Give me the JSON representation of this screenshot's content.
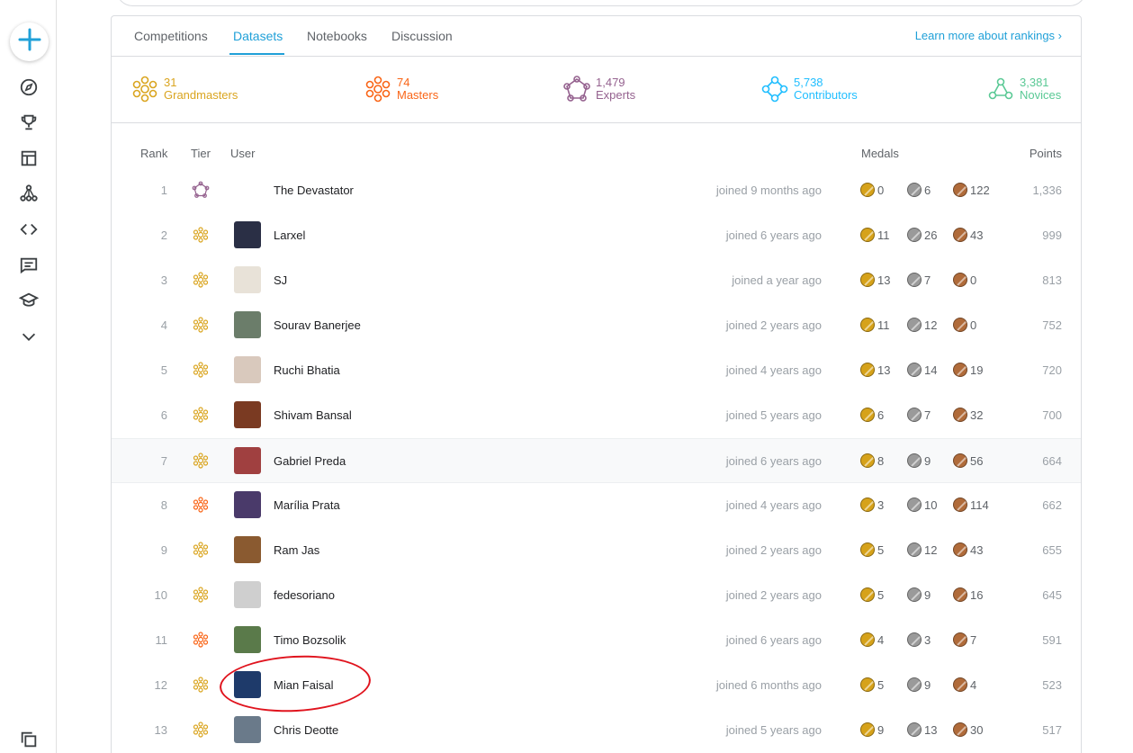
{
  "sidebar": {
    "icons": [
      "plus-icon",
      "compass-icon",
      "trophy-icon",
      "table-icon",
      "model-icon",
      "code-icon",
      "discussion-icon",
      "learn-icon",
      "chevron-down-icon",
      "copy-icon"
    ]
  },
  "tabs": [
    {
      "label": "Competitions",
      "active": false
    },
    {
      "label": "Datasets",
      "active": true
    },
    {
      "label": "Notebooks",
      "active": false
    },
    {
      "label": "Discussion",
      "active": false
    }
  ],
  "learn_more": "Learn more about rankings ›",
  "tiers": [
    {
      "count": "31",
      "label": "Grandmasters",
      "color": "#daa520"
    },
    {
      "count": "74",
      "label": "Masters",
      "color": "#f96517"
    },
    {
      "count": "1,479",
      "label": "Experts",
      "color": "#95628f"
    },
    {
      "count": "5,738",
      "label": "Contributors",
      "color": "#20beff"
    },
    {
      "count": "3,381",
      "label": "Novices",
      "color": "#5ac995"
    }
  ],
  "headers": {
    "rank": "Rank",
    "tier": "Tier",
    "user": "User",
    "medals": "Medals",
    "points": "Points"
  },
  "rows": [
    {
      "rank": "1",
      "tier": "expert",
      "name": "The Devastator",
      "joined": "joined 9 months ago",
      "gold": "0",
      "silver": "6",
      "bronze": "122",
      "points": "1,336",
      "avatar": ""
    },
    {
      "rank": "2",
      "tier": "grandmaster",
      "name": "Larxel",
      "joined": "joined 6 years ago",
      "gold": "11",
      "silver": "26",
      "bronze": "43",
      "points": "999",
      "avatar": "#2a2f45"
    },
    {
      "rank": "3",
      "tier": "grandmaster",
      "name": "SJ",
      "joined": "joined a year ago",
      "gold": "13",
      "silver": "7",
      "bronze": "0",
      "points": "813",
      "avatar": "#e8e2d8"
    },
    {
      "rank": "4",
      "tier": "grandmaster",
      "name": "Sourav Banerjee",
      "joined": "joined 2 years ago",
      "gold": "11",
      "silver": "12",
      "bronze": "0",
      "points": "752",
      "avatar": "#6b7d6a"
    },
    {
      "rank": "5",
      "tier": "grandmaster",
      "name": "Ruchi Bhatia",
      "joined": "joined 4 years ago",
      "gold": "13",
      "silver": "14",
      "bronze": "19",
      "points": "720",
      "avatar": "#d9c9bd"
    },
    {
      "rank": "6",
      "tier": "grandmaster",
      "name": "Shivam Bansal",
      "joined": "joined 5 years ago",
      "gold": "6",
      "silver": "7",
      "bronze": "32",
      "points": "700",
      "avatar": "#7a3a22"
    },
    {
      "rank": "7",
      "tier": "grandmaster",
      "name": "Gabriel Preda",
      "joined": "joined 6 years ago",
      "gold": "8",
      "silver": "9",
      "bronze": "56",
      "points": "664",
      "avatar": "#a04040",
      "highlight": true
    },
    {
      "rank": "8",
      "tier": "master",
      "name": "Marília Prata",
      "joined": "joined 4 years ago",
      "gold": "3",
      "silver": "10",
      "bronze": "114",
      "points": "662",
      "avatar": "#4a3a6a"
    },
    {
      "rank": "9",
      "tier": "grandmaster",
      "name": "Ram Jas",
      "joined": "joined 2 years ago",
      "gold": "5",
      "silver": "12",
      "bronze": "43",
      "points": "655",
      "avatar": "#8a5a30"
    },
    {
      "rank": "10",
      "tier": "grandmaster",
      "name": "fedesoriano",
      "joined": "joined 2 years ago",
      "gold": "5",
      "silver": "9",
      "bronze": "16",
      "points": "645",
      "avatar": "#cfcfcf"
    },
    {
      "rank": "11",
      "tier": "master",
      "name": "Timo Bozsolik",
      "joined": "joined 6 years ago",
      "gold": "4",
      "silver": "3",
      "bronze": "7",
      "points": "591",
      "avatar": "#5a7a4a"
    },
    {
      "rank": "12",
      "tier": "grandmaster",
      "name": "Mian Faisal",
      "joined": "joined 6 months ago",
      "gold": "5",
      "silver": "9",
      "bronze": "4",
      "points": "523",
      "avatar": "#1e3a6a"
    },
    {
      "rank": "13",
      "tier": "grandmaster",
      "name": "Chris Deotte",
      "joined": "joined 5 years ago",
      "gold": "9",
      "silver": "13",
      "bronze": "30",
      "points": "517",
      "avatar": "#6a7a8a"
    }
  ]
}
